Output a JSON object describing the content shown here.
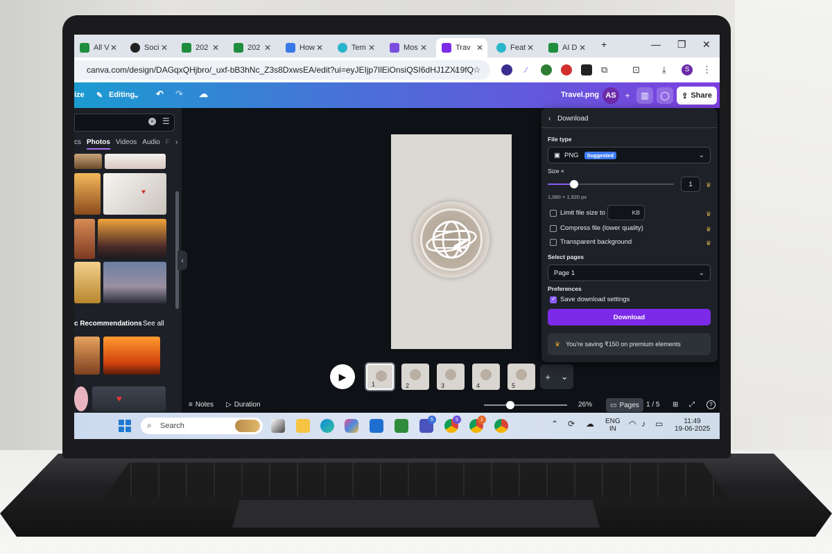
{
  "browser": {
    "tabs": [
      {
        "label": "All V",
        "color": "#1e8e3e"
      },
      {
        "label": "Soci",
        "color": "#222222"
      },
      {
        "label": "202",
        "color": "#1e8e3e"
      },
      {
        "label": "202",
        "color": "#1e8e3e"
      },
      {
        "label": "How",
        "color": "#3b78e7"
      },
      {
        "label": "Tem",
        "color": "#28b5c9"
      },
      {
        "label": "Mos",
        "color": "#7a4fe0"
      },
      {
        "label": "Trav",
        "color": "#7d2ae8"
      },
      {
        "label": "Feat",
        "color": "#28b5c9"
      },
      {
        "label": "AI D",
        "color": "#1e8e3e"
      }
    ],
    "new_tab_icon": "+",
    "url": "canva.com/design/DAGqxQHjbro/_uxf-bB3hNc_Z3s8DxwsEA/edit?ui=eyJEIjp7IlEiOnsiQSI6dHJ1ZX19fQ",
    "profile_initial": "S"
  },
  "canva": {
    "resize_label": "ize",
    "editing_label": "Editing",
    "file_title": "Travel.png",
    "avatar_initials": "AS",
    "share_label": "Share"
  },
  "left_panel": {
    "media_tabs": [
      "cs",
      "Photos",
      "Videos",
      "Audio",
      "F"
    ],
    "active_tab": "Photos",
    "recommendations_title": "c Recommendations",
    "see_all": "See all"
  },
  "download_panel": {
    "header": "Download",
    "file_type_label": "File type",
    "file_type_value": "PNG",
    "suggested_badge": "Suggested",
    "size_label": "Size ×",
    "size_value": "1",
    "dimensions": "1,080 × 1,920 px",
    "size_slider_fraction": 0.2,
    "options": [
      {
        "label": "Limit file size to",
        "checked": false
      },
      {
        "label": "Compress file (lower quality)",
        "checked": false
      },
      {
        "label": "Transparent background",
        "checked": false
      }
    ],
    "kb_unit": "KB",
    "select_pages_label": "Select pages",
    "pages_value": "Page 1",
    "preferences_label": "Preferences",
    "save_settings_label": "Save download settings",
    "save_settings_checked": true,
    "download_button": "Download",
    "saving_note": "You're saving ₹150 on premium elements"
  },
  "pages": {
    "thumbnails": [
      "1",
      "2",
      "3",
      "4",
      "5"
    ],
    "selected": "1"
  },
  "bottom_bar": {
    "notes": "Notes",
    "duration": "Duration",
    "zoom": "26%",
    "zoom_fraction": 0.26,
    "pages_label": "Pages",
    "page_count": "1 / 5",
    "help": "?"
  },
  "taskbar": {
    "search_placeholder": "Search",
    "badge_teams": "5",
    "badge_chrome1": "5",
    "badge_chrome2": "1",
    "lang_line1": "ENG",
    "lang_line2": "IN",
    "time": "11:49",
    "date": "19-06-2025"
  },
  "colors": {
    "canva_purple": "#7d2ae8",
    "header_gradient_start": "#1b9bd1",
    "header_gradient_end": "#7d3fe0",
    "panel_bg": "#1e2228"
  }
}
